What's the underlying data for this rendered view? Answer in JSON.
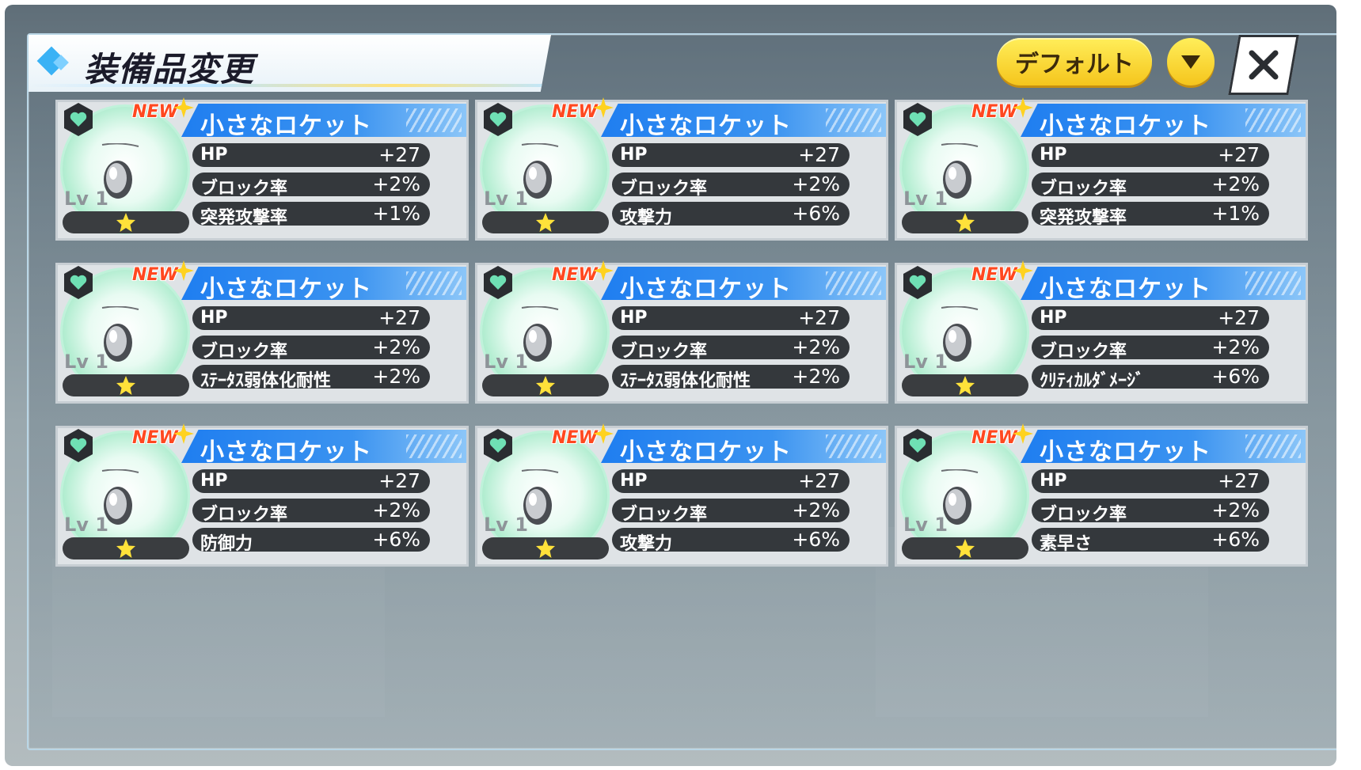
{
  "header": {
    "title": "装備品変更",
    "default_label": "デフォルト"
  },
  "colors": {
    "accent": "#2f8ef2",
    "button_yellow": "#f9d534",
    "card_bg": "#dfe3e6"
  },
  "icons": [
    "diamond-icon",
    "chevron-down-icon",
    "close-icon",
    "heart-hexagon-icon",
    "locket-icon",
    "star-icon",
    "sparkle-icon"
  ],
  "cards": [
    {
      "name": "小さなロケット",
      "badge": "NEW",
      "level": "Lv 1",
      "stats": [
        {
          "label": "HP",
          "value": "+27"
        },
        {
          "label": "ブロック率",
          "value": "+2%"
        },
        {
          "label": "突発攻撃率",
          "value": "+1%"
        }
      ]
    },
    {
      "name": "小さなロケット",
      "badge": "NEW",
      "level": "Lv 1",
      "stats": [
        {
          "label": "HP",
          "value": "+27"
        },
        {
          "label": "ブロック率",
          "value": "+2%"
        },
        {
          "label": "攻撃力",
          "value": "+6%"
        }
      ]
    },
    {
      "name": "小さなロケット",
      "badge": "NEW",
      "level": "Lv 1",
      "stats": [
        {
          "label": "HP",
          "value": "+27"
        },
        {
          "label": "ブロック率",
          "value": "+2%"
        },
        {
          "label": "突発攻撃率",
          "value": "+1%"
        }
      ]
    },
    {
      "name": "小さなロケット",
      "badge": "NEW",
      "level": "Lv 1",
      "stats": [
        {
          "label": "HP",
          "value": "+27"
        },
        {
          "label": "ブロック率",
          "value": "+2%"
        },
        {
          "label": "ｽﾃｰﾀｽ弱体化耐性",
          "value": "+2%"
        }
      ]
    },
    {
      "name": "小さなロケット",
      "badge": "NEW",
      "level": "Lv 1",
      "stats": [
        {
          "label": "HP",
          "value": "+27"
        },
        {
          "label": "ブロック率",
          "value": "+2%"
        },
        {
          "label": "ｽﾃｰﾀｽ弱体化耐性",
          "value": "+2%"
        }
      ]
    },
    {
      "name": "小さなロケット",
      "badge": "NEW",
      "level": "Lv 1",
      "stats": [
        {
          "label": "HP",
          "value": "+27"
        },
        {
          "label": "ブロック率",
          "value": "+2%"
        },
        {
          "label": "ｸﾘﾃｨｶﾙﾀﾞﾒｰｼﾞ",
          "value": "+6%"
        }
      ]
    },
    {
      "name": "小さなロケット",
      "badge": "NEW",
      "level": "Lv 1",
      "stats": [
        {
          "label": "HP",
          "value": "+27"
        },
        {
          "label": "ブロック率",
          "value": "+2%"
        },
        {
          "label": "防御力",
          "value": "+6%"
        }
      ]
    },
    {
      "name": "小さなロケット",
      "badge": "NEW",
      "level": "Lv 1",
      "stats": [
        {
          "label": "HP",
          "value": "+27"
        },
        {
          "label": "ブロック率",
          "value": "+2%"
        },
        {
          "label": "攻撃力",
          "value": "+6%"
        }
      ]
    },
    {
      "name": "小さなロケット",
      "badge": "NEW",
      "level": "Lv 1",
      "stats": [
        {
          "label": "HP",
          "value": "+27"
        },
        {
          "label": "ブロック率",
          "value": "+2%"
        },
        {
          "label": "素早さ",
          "value": "+6%"
        }
      ]
    }
  ]
}
